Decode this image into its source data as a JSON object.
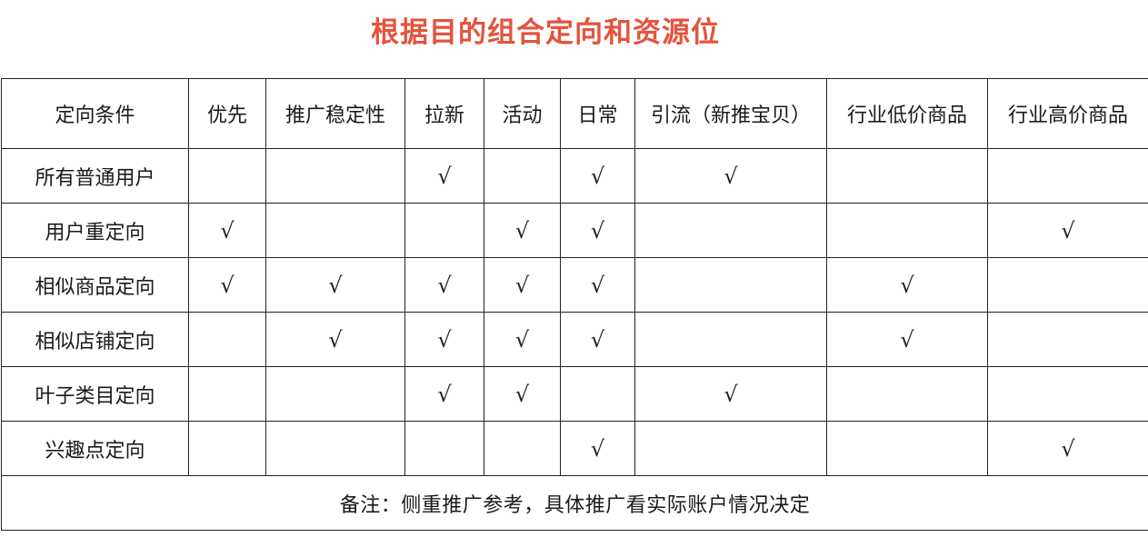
{
  "title": "根据目的组合定向和资源位",
  "check_mark": "√",
  "columns": [
    "定向条件",
    "优先",
    "推广稳定性",
    "拉新",
    "活动",
    "日常",
    "引流（新推宝贝）",
    "行业低价商品",
    "行业高价商品"
  ],
  "rows": [
    {
      "label": "所有普通用户",
      "cells": [
        "",
        "",
        "√",
        "",
        "√",
        "√",
        "",
        ""
      ]
    },
    {
      "label": "用户重定向",
      "cells": [
        "√",
        "",
        "",
        "√",
        "√",
        "",
        "",
        "√"
      ]
    },
    {
      "label": "相似商品定向",
      "cells": [
        "√",
        "√",
        "√",
        "√",
        "√",
        "",
        "√",
        ""
      ]
    },
    {
      "label": "相似店铺定向",
      "cells": [
        "",
        "√",
        "√",
        "√",
        "√",
        "",
        "√",
        ""
      ]
    },
    {
      "label": "叶子类目定向",
      "cells": [
        "",
        "",
        "√",
        "√",
        "",
        "√",
        "",
        ""
      ]
    },
    {
      "label": "兴趣点定向",
      "cells": [
        "",
        "",
        "",
        "",
        "√",
        "",
        "",
        "√"
      ]
    }
  ],
  "note": "备注：侧重推广参考，具体推广看实际账户情况决定",
  "colors": {
    "title": "#e4533c",
    "border": "#222222"
  }
}
